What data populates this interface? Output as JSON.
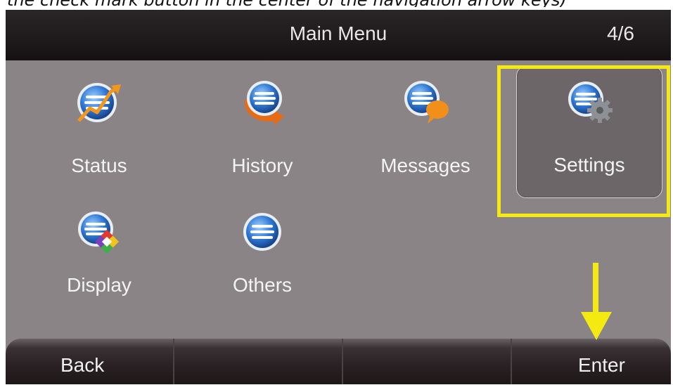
{
  "caption": "the check mark button in the center of the navigation arrow keys)",
  "header": {
    "title": "Main Menu",
    "page": "4/6"
  },
  "menu": {
    "items": [
      {
        "label": "Status",
        "icon": "status-chart-icon"
      },
      {
        "label": "History",
        "icon": "history-arrow-icon"
      },
      {
        "label": "Messages",
        "icon": "messages-bubble-icon"
      },
      {
        "label": "Settings",
        "icon": "settings-gear-icon",
        "selected": true
      },
      {
        "label": "Display",
        "icon": "display-color-icon"
      },
      {
        "label": "Others",
        "icon": "others-list-icon"
      }
    ]
  },
  "softkeys": [
    "Back",
    "",
    "",
    "Enter"
  ],
  "annotation": {
    "highlight_color": "#f4ea12",
    "arrow_color": "#f4ea12"
  }
}
